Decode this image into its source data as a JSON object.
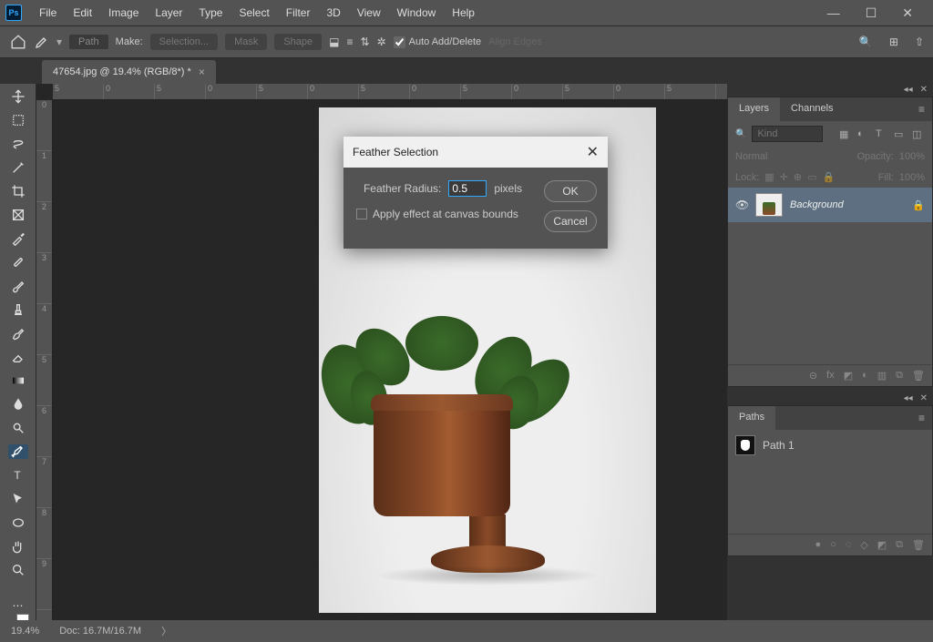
{
  "app": {
    "logo": "Ps"
  },
  "menu": [
    "File",
    "Edit",
    "Image",
    "Layer",
    "Type",
    "Select",
    "Filter",
    "3D",
    "View",
    "Window",
    "Help"
  ],
  "options": {
    "path_label": "Path",
    "make": "Make:",
    "selection": "Selection...",
    "mask": "Mask",
    "shape": "Shape",
    "auto": "Auto Add/Delete",
    "align": "Align Edges"
  },
  "doc_tab": "47654.jpg @ 19.4% (RGB/8*) *",
  "ruler_h": [
    "5",
    "0",
    "5",
    "0",
    "5",
    "0",
    "5",
    "0",
    "5",
    "0",
    "5",
    "0",
    "5"
  ],
  "ruler_v": [
    "0",
    "1",
    "2",
    "3",
    "4",
    "5",
    "6",
    "7",
    "8",
    "9"
  ],
  "dialog": {
    "title": "Feather Selection",
    "radius_label": "Feather Radius:",
    "radius_value": "0.5",
    "unit": "pixels",
    "checkbox": "Apply effect at canvas bounds",
    "ok": "OK",
    "cancel": "Cancel"
  },
  "layers_panel": {
    "tab1": "Layers",
    "tab2": "Channels",
    "search_placeholder": "Kind",
    "blend": "Normal",
    "opacity_label": "Opacity:",
    "opacity_val": "100%",
    "lock_label": "Lock:",
    "fill_label": "Fill:",
    "fill_val": "100%",
    "layer_name": "Background",
    "footer_icons": [
      "⊝",
      "fx",
      "◩",
      "◐",
      "▥",
      "⧉",
      "🗑"
    ]
  },
  "paths_panel": {
    "tab": "Paths",
    "path_name": "Path 1",
    "footer_icons": [
      "●",
      "○",
      "◌",
      "◇",
      "◩",
      "⧉",
      "🗑"
    ]
  },
  "status": {
    "zoom": "19.4%",
    "doc": "Doc: 16.7M/16.7M"
  }
}
